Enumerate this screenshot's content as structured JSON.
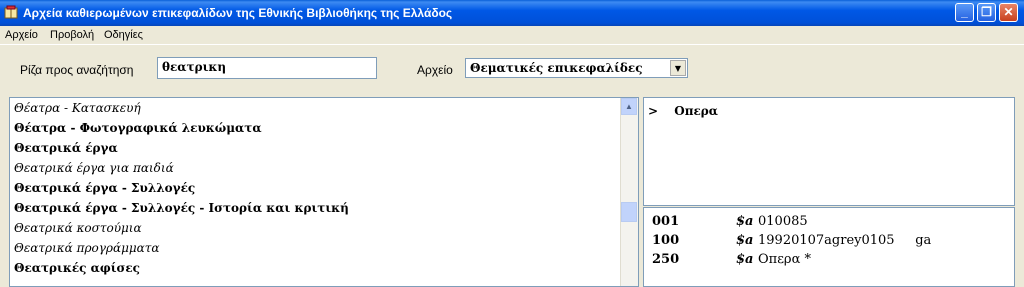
{
  "window": {
    "title": "Αρχεία καθιερωμένων επικεφαλίδων της Εθνικής Βιβλιοθήκης της Ελλάδος",
    "minimize": "_",
    "maximize": "❐",
    "close": "✕"
  },
  "menu": {
    "items": [
      "Αρχείο",
      "Προβολή",
      "Οδηγίες"
    ]
  },
  "search": {
    "root_label": "Ρίζα προς αναζήτηση",
    "root_value": "θεατρικη",
    "file_label": "Αρχείο",
    "file_selected": "Θεματικές επικεφαλίδες"
  },
  "headings_list": [
    {
      "text": "Θέατρα - Κατασκευή",
      "style": "italic"
    },
    {
      "text": "Θέατρα - Φωτογραφικά λευκώματα",
      "style": "bold"
    },
    {
      "text": "Θεατρικά έργα",
      "style": "bold"
    },
    {
      "text": "Θεατρικά έργα για παιδιά",
      "style": "italic"
    },
    {
      "text": "Θεατρικά έργα - Συλλογές",
      "style": "bold"
    },
    {
      "text": "Θεατρικά έργα - Συλλογές - Ιστορία και κριτική",
      "style": "bold"
    },
    {
      "text": "Θεατρικά κοστούμια",
      "style": "italic"
    },
    {
      "text": "Θεατρικά προγράμματα",
      "style": "italic"
    },
    {
      "text": "Θεατρικές αφίσες",
      "style": "bold"
    }
  ],
  "references": {
    "marker": ">",
    "text": "Οπερα"
  },
  "marc_record": [
    {
      "tag": "001",
      "subfield": "$a",
      "value": "010085"
    },
    {
      "tag": "100",
      "subfield": "$a",
      "value": "19920107agrey0105     ga"
    },
    {
      "tag": "250",
      "subfield": "$a",
      "value": "Οπερα *"
    }
  ]
}
